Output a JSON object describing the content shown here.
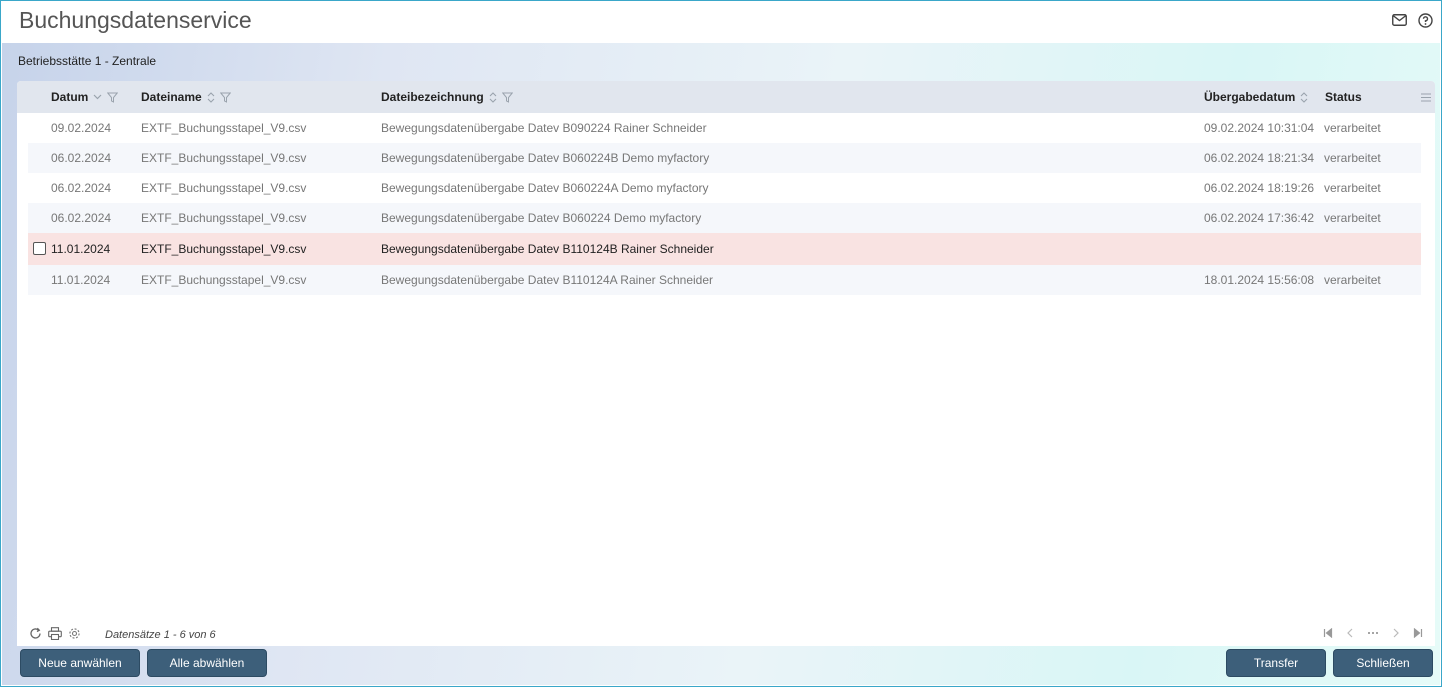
{
  "window": {
    "title": "Buchungsdatenservice",
    "icons": [
      "mail-icon",
      "help-icon"
    ]
  },
  "location": "Betriebsstätte 1 - Zentrale",
  "grid": {
    "columns": {
      "datum": "Datum",
      "dateiname": "Dateiname",
      "dateibezeichnung": "Dateibezeichnung",
      "uebergabedatum": "Übergabedatum",
      "status": "Status"
    },
    "rows": [
      {
        "datum": "09.02.2024",
        "dateiname": "EXTF_Buchungsstapel_V9.csv",
        "bezeichnung": "Bewegungsdatenübergabe Datev B090224 Rainer Schneider",
        "uebergabe": "09.02.2024 10:31:04",
        "status": "verarbeitet"
      },
      {
        "datum": "06.02.2024",
        "dateiname": "EXTF_Buchungsstapel_V9.csv",
        "bezeichnung": "Bewegungsdatenübergabe Datev B060224B Demo myfactory",
        "uebergabe": "06.02.2024 18:21:34",
        "status": "verarbeitet"
      },
      {
        "datum": "06.02.2024",
        "dateiname": "EXTF_Buchungsstapel_V9.csv",
        "bezeichnung": "Bewegungsdatenübergabe Datev B060224A Demo myfactory",
        "uebergabe": "06.02.2024 18:19:26",
        "status": "verarbeitet"
      },
      {
        "datum": "06.02.2024",
        "dateiname": "EXTF_Buchungsstapel_V9.csv",
        "bezeichnung": "Bewegungsdatenübergabe Datev B060224 Demo myfactory",
        "uebergabe": "06.02.2024 17:36:42",
        "status": "verarbeitet"
      },
      {
        "datum": "11.01.2024",
        "dateiname": "EXTF_Buchungsstapel_V9.csv",
        "bezeichnung": "Bewegungsdatenübergabe Datev B110124B Rainer Schneider",
        "uebergabe": "",
        "status": ""
      },
      {
        "datum": "11.01.2024",
        "dateiname": "EXTF_Buchungsstapel_V9.csv",
        "bezeichnung": "Bewegungsdatenübergabe Datev B110124A Rainer Schneider",
        "uebergabe": "18.01.2024 15:56:08",
        "status": "verarbeitet"
      }
    ],
    "record_count": "Datensätze 1 - 6 von 6"
  },
  "buttons": {
    "neue_anwaehlen": "Neue anwählen",
    "alle_abwaehlen": "Alle abwählen",
    "transfer": "Transfer",
    "schliessen": "Schließen"
  },
  "colors": {
    "button_bg": "#3d5f7a",
    "error_row": "#f9e3e2",
    "header_bg": "#e1e6ee"
  }
}
